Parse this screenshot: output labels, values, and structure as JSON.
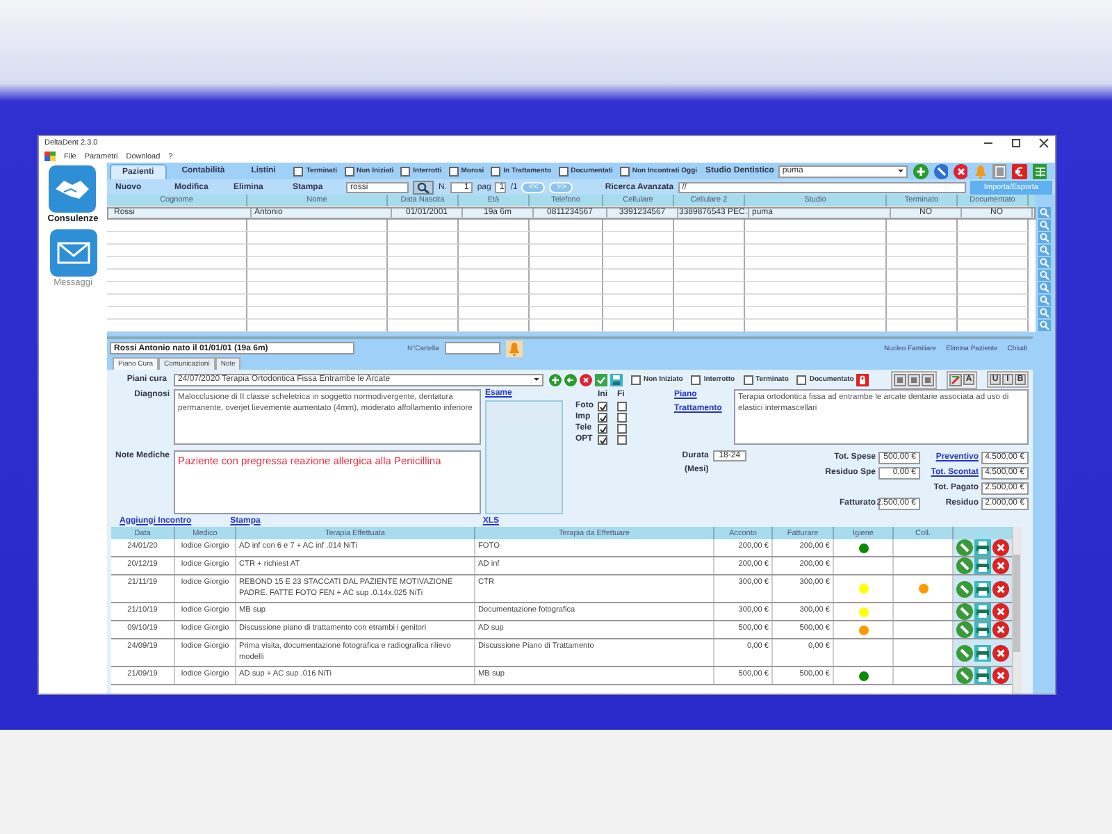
{
  "window": {
    "title": "DeltaDent 2.3.0"
  },
  "menu": [
    "File",
    "Parametri",
    "Download",
    "?"
  ],
  "sidebar": [
    {
      "label": "Consulenze",
      "kind": "handshake",
      "selected": true
    },
    {
      "label": "Messaggi",
      "kind": "envelope",
      "selected": false
    }
  ],
  "tabs": [
    {
      "label": "Pazienti",
      "selected": true
    },
    {
      "label": "Contabilità",
      "selected": false
    },
    {
      "label": "Listini",
      "selected": false
    }
  ],
  "filters": [
    {
      "label": "Terminati",
      "checked": false
    },
    {
      "label": "Non Iniziati",
      "checked": false
    },
    {
      "label": "Interrotti",
      "checked": false
    },
    {
      "label": "Morosi",
      "checked": false
    },
    {
      "label": "In Trattamento",
      "checked": false
    },
    {
      "label": "Documentati",
      "checked": false
    },
    {
      "label": "Non Incontrati Oggi",
      "checked": false
    }
  ],
  "studio": {
    "label": "Studio Dentistico",
    "value": "puma"
  },
  "actions": [
    "Nuovo",
    "Modifica",
    "Elimina",
    "Stampa"
  ],
  "search": {
    "value": "rossi"
  },
  "pager": {
    "n_label": "N.",
    "n_value": "1",
    "pag_label": "pag",
    "page": "1",
    "total": "/1",
    "prev": "<<",
    "next": ">>"
  },
  "advanced_search": {
    "label": "Ricerca Avanzata",
    "value": "//"
  },
  "import_export": "Importa/Esporta",
  "patients": {
    "columns": [
      "Cognome",
      "Nome",
      "Data Nascita",
      "Età",
      "Telefono",
      "Cellulare",
      "Cellulare 2",
      "Studio",
      "Terminato",
      "Documentato"
    ],
    "rows": [
      {
        "cells": [
          "Rossi",
          "Antonio",
          "01/01/2001",
          "19a 6m",
          "0811234567",
          "3391234567",
          "3389876543 PEC.",
          "puma",
          "NO",
          "NO"
        ],
        "selected": true
      }
    ]
  },
  "patient_panel": {
    "title": "Rossi Antonio nato il 01/01/01 (19a 6m)",
    "folder_label": "N°Cartella",
    "links": [
      "Nucleo Familiare",
      "Elimina Paziente",
      "Chiudi"
    ]
  },
  "panel_tabs": [
    {
      "label": "Piano Cura",
      "selected": true
    },
    {
      "label": "Comunicazioni",
      "selected": false
    },
    {
      "label": "Note",
      "selected": false
    }
  ],
  "plan": {
    "label": "Piani cura",
    "value": "24/07/2020 Terapia Ortodontica Fissa Entrambe le Arcate",
    "states": [
      {
        "label": "Non Iniziato",
        "checked": false
      },
      {
        "label": "Interrotto",
        "checked": false
      },
      {
        "label": "Terminato",
        "checked": false
      },
      {
        "label": "Documentato",
        "checked": false
      }
    ],
    "format_buttons": [
      "A",
      "U",
      "I",
      "B"
    ]
  },
  "diagnosis": {
    "label": "Diagnosi",
    "text": "Malocclusione di II classe scheletrica in soggetto normodivergente, dentatura permanente, overjet lievemente aumentato (4mm), moderato affollamento inferiore"
  },
  "exam": {
    "label": "Esame"
  },
  "xray": {
    "headers": [
      "Ini",
      "Fi"
    ],
    "rows": [
      {
        "label": "Foto",
        "ini": true,
        "fi": false
      },
      {
        "label": "Imp",
        "ini": true,
        "fi": false
      },
      {
        "label": "Tele",
        "ini": true,
        "fi": false
      },
      {
        "label": "OPT",
        "ini": true,
        "fi": false
      }
    ]
  },
  "treatment_plan": {
    "label": "Piano Trattamento",
    "text": "Terapia ortodontica fissa ad entrambe le arcate dentarie associata ad uso di elastici intermascellari"
  },
  "medical_notes": {
    "label": "Note Mediche",
    "text": "Paziente con pregressa reazione allergica alla Penicillina"
  },
  "duration": {
    "label": "Durata (Mesi)",
    "value": "18-24"
  },
  "totals": [
    {
      "left": {
        "label": "Tot. Spese",
        "value": "500,00 €"
      },
      "right": {
        "label": "Preventivo",
        "value": "4.500,00 €",
        "kind": "link"
      }
    },
    {
      "left": {
        "label": "Residuo Spe",
        "value": "0,00 €"
      },
      "right": {
        "label": "Tot. Scontat",
        "value": "4.500,00 €",
        "kind": "link"
      }
    },
    {
      "right": {
        "label": "Tot. Pagato",
        "value": "2.500,00 €",
        "kind": "label"
      }
    },
    {
      "left": {
        "label": "Fatturato",
        "value": "2.500,00 €"
      },
      "right": {
        "label": "Residuo",
        "value": "2.000,00 €",
        "kind": "label"
      }
    }
  ],
  "links": [
    "Aggiungi Incontro",
    "Stampa",
    "XLS"
  ],
  "visits": {
    "columns": [
      "Data",
      "Medico",
      "Terapia Effettuata",
      "Terapia da Effettuare",
      "Acconto",
      "Fatturare",
      "Igiene",
      "Coll."
    ],
    "rows": [
      {
        "date": "24/01/20",
        "doctor": "Iodice Giorgio",
        "done": "AD inf con 6 e 7 + AC inf .014 NiTi",
        "todo": "FOTO",
        "deposit": "200,00 €",
        "invoice": "200,00 €",
        "hygiene": {
          "color": "#0a8a0a"
        }
      },
      {
        "date": "20/12/19",
        "doctor": "Iodice Giorgio",
        "done": "CTR + richiest AT",
        "todo": "AD inf",
        "deposit": "200,00 €",
        "invoice": "200,00 €"
      },
      {
        "date": "21/11/19",
        "doctor": "Iodice Giorgio",
        "done": "REBOND 15 E 23 STACCATI DAL PAZIENTE MOTIVAZIONE PADRE. FATTE FOTO FEN + AC sup .0.14x.025 NiTi",
        "todo": "CTR",
        "deposit": "300,00 €",
        "invoice": "300,00 €",
        "hygiene": {
          "color": "#ffff00"
        },
        "coll": {
          "color": "#ff9900"
        }
      },
      {
        "date": "21/10/19",
        "doctor": "Iodice Giorgio",
        "done": "MB sup",
        "todo": "Documentazione fotografica",
        "deposit": "300,00 €",
        "invoice": "300,00 €",
        "hygiene": {
          "color": "#ffff00"
        }
      },
      {
        "date": "09/10/19",
        "doctor": "Iodice Giorgio",
        "done": "Discussione piano di trattamento con etrambi i genitori",
        "todo": "AD sup",
        "deposit": "500,00 €",
        "invoice": "500,00 €",
        "hygiene": {
          "color": "#ff9900"
        }
      },
      {
        "date": "24/09/19",
        "doctor": "Iodice Giorgio",
        "done": "Prima visita, documentazione fotografica e radiografica rilievo modelli",
        "todo": "Discussione Piano di Trattamento",
        "deposit": "0,00 €",
        "invoice": "0,00 €"
      },
      {
        "date": "21/09/19",
        "doctor": "Iodice Giorgio",
        "done": "AD sup + AC sup .016 NiTi",
        "todo": "MB sup",
        "deposit": "500,00 €",
        "invoice": "500,00 €",
        "hygiene": {
          "color": "#0a8a0a"
        }
      }
    ]
  }
}
